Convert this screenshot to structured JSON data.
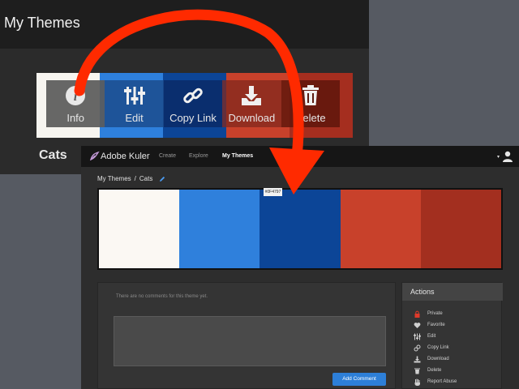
{
  "back_panel": {
    "title": "My Themes",
    "theme_name": "Cats",
    "swatch_colors": [
      "#f7f5f0",
      "#2e80dd",
      "#0c4597",
      "#c8412b",
      "#a52e1f"
    ],
    "outline_color": "#ffffff",
    "outline_right_color": "#c8412b"
  },
  "overlay_toolbar": {
    "buttons": [
      {
        "label": "Info",
        "icon": "info-icon"
      },
      {
        "label": "Edit",
        "icon": "sliders-icon"
      },
      {
        "label": "Copy Link",
        "icon": "link-icon"
      },
      {
        "label": "Download",
        "icon": "download-icon"
      },
      {
        "label": "Delete",
        "icon": "trash-icon"
      }
    ]
  },
  "kuler": {
    "brand": "Adobe Kuler",
    "nav": {
      "create": "Create",
      "explore": "Explore",
      "my_themes": "My Themes"
    },
    "breadcrumb": {
      "parent": "My Themes",
      "separator": "/",
      "current": "Cats"
    },
    "palette": {
      "colors": [
        "#fbf8f3",
        "#2f80dc",
        "#0c4597",
        "#c8412b",
        "#a32f1f"
      ],
      "hex_tooltip": "#0F4797"
    },
    "comments": {
      "empty_text": "There are no comments for this theme yet.",
      "button_label": "Add Comment"
    },
    "actions": {
      "title": "Actions",
      "items": [
        {
          "label": "Private",
          "icon": "lock-icon",
          "color": "#e03a2a"
        },
        {
          "label": "Favorite",
          "icon": "heart-icon"
        },
        {
          "label": "Edit",
          "icon": "sliders-icon"
        },
        {
          "label": "Copy Link",
          "icon": "link-icon"
        },
        {
          "label": "Download",
          "icon": "download-icon"
        },
        {
          "label": "Delete",
          "icon": "trash-icon"
        },
        {
          "label": "Report Abuse",
          "icon": "hand-icon"
        }
      ]
    }
  },
  "annotation": {
    "arrow_color": "#ff2a00"
  }
}
